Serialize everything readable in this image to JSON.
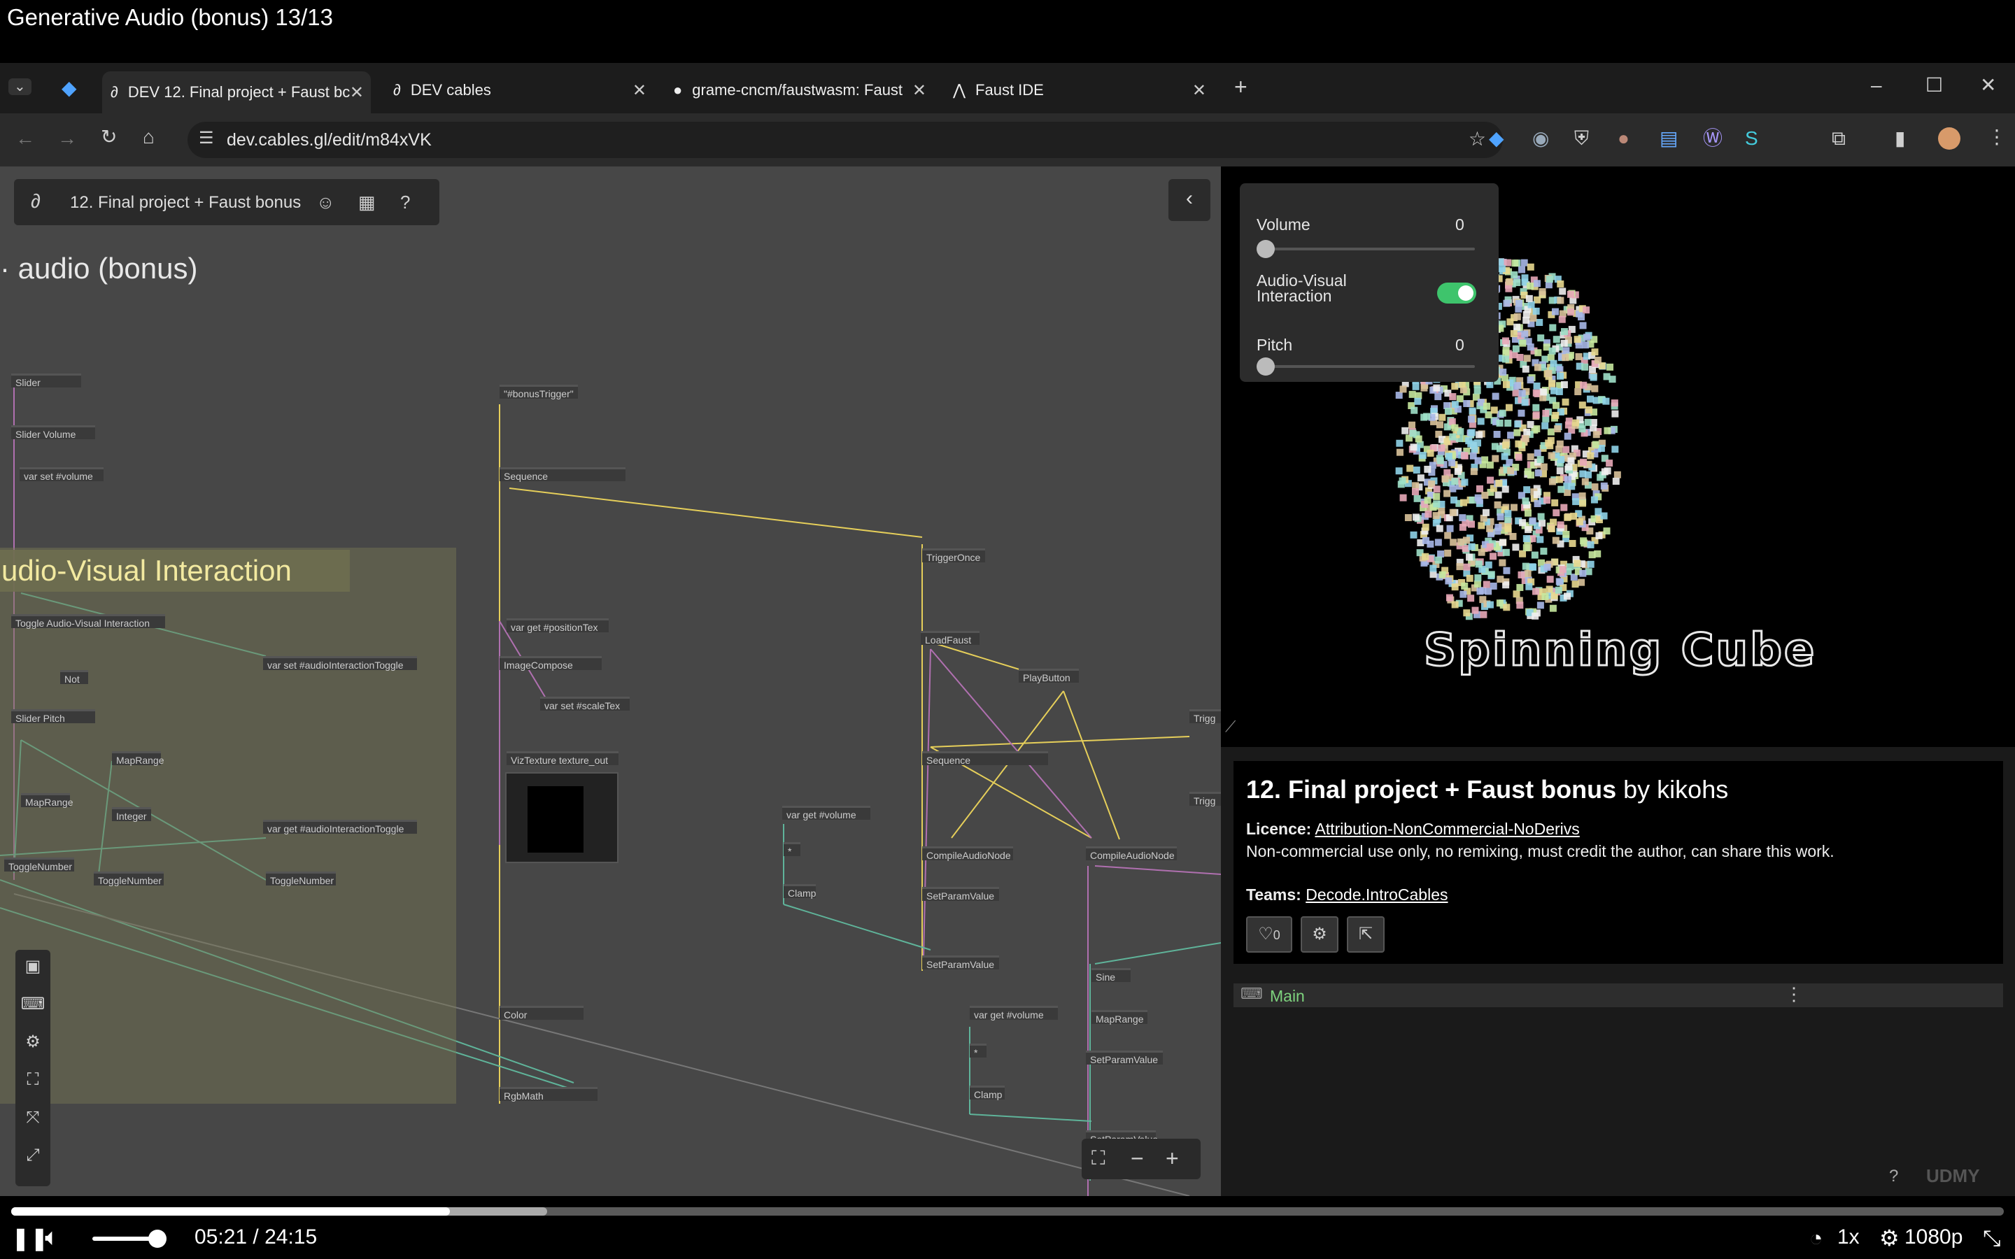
{
  "video": {
    "title": "Generative Audio (bonus) 13/13",
    "time": "05:21 / 24:15",
    "speed": "1x",
    "quality": "1080p",
    "progress_fraction": 0.22
  },
  "browser": {
    "tabs": [
      {
        "label": "DEV 12. Final project + Faust bc",
        "active": true
      },
      {
        "label": "DEV cables",
        "active": false
      },
      {
        "label": "grame-cncm/faustwasm: Faust",
        "active": false
      },
      {
        "label": "Faust IDE",
        "active": false
      }
    ],
    "url": "dev.cables.gl/edit/m84xVK"
  },
  "editor": {
    "project_name": "12. Final project + Faust bonus",
    "section_title": "audio (bonus)",
    "comment_title": "udio-Visual Interaction",
    "ops": [
      {
        "label": "Slider",
        "c": "p"
      },
      {
        "label": "Slider  Volume",
        "c": "p"
      },
      {
        "label": "var  set  #volume",
        "c": "g"
      },
      {
        "label": "\"#bonusTrigger\"",
        "c": "y"
      },
      {
        "label": "Sequence",
        "c": "y"
      },
      {
        "label": "TriggerOnce",
        "c": "y"
      },
      {
        "label": "Toggle  Audio-Visual  Interaction",
        "c": "p"
      },
      {
        "label": "var  set  #audioInteractionToggle",
        "c": "g"
      },
      {
        "label": "Not",
        "c": "g"
      },
      {
        "label": "Slider  Pitch",
        "c": "p"
      },
      {
        "label": "MapRange",
        "c": "g"
      },
      {
        "label": "MapRange",
        "c": "g"
      },
      {
        "label": "Integer",
        "c": "g"
      },
      {
        "label": "var  get  #audioInteractionToggle",
        "c": "g"
      },
      {
        "label": "ToggleNumber",
        "c": "g"
      },
      {
        "label": "ToggleNumber",
        "c": "g"
      },
      {
        "label": "ToggleNumber",
        "c": "g"
      },
      {
        "label": "var  get  #positionTex",
        "c": "p"
      },
      {
        "label": "ImageCompose",
        "c": "p"
      },
      {
        "label": "var  set  #scaleTex",
        "c": "p"
      },
      {
        "label": "VizTexture  texture_out",
        "c": "p"
      },
      {
        "label": "LoadFaust",
        "c": "y"
      },
      {
        "label": "PlayButton",
        "c": "y"
      },
      {
        "label": "Sequence",
        "c": "y"
      },
      {
        "label": "Trigg",
        "c": "y"
      },
      {
        "label": "Trigg",
        "c": "y"
      },
      {
        "label": "var  get  #volume",
        "c": "g"
      },
      {
        "label": "*",
        "c": "g"
      },
      {
        "label": "Clamp",
        "c": "g"
      },
      {
        "label": "CompileAudioNode",
        "c": "y"
      },
      {
        "label": "CompileAudioNode",
        "c": "y"
      },
      {
        "label": "SetParamValue",
        "c": "y"
      },
      {
        "label": "SetParamValue",
        "c": "y"
      },
      {
        "label": "Sine",
        "c": "g"
      },
      {
        "label": "MapRange",
        "c": "g"
      },
      {
        "label": "SetParamValue",
        "c": "y"
      },
      {
        "label": "var  get  #volume",
        "c": "g"
      },
      {
        "label": "*",
        "c": "g"
      },
      {
        "label": "Clamp",
        "c": "g"
      },
      {
        "label": "Color",
        "c": "y"
      },
      {
        "label": "RgbMath",
        "c": "y"
      },
      {
        "label": "SetParamValue",
        "c": "y"
      }
    ]
  },
  "gui": {
    "volume_label": "Volume",
    "volume_value": "0",
    "volume_fraction": 0,
    "toggle_label": "Audio-Visual Interaction",
    "toggle_on": true,
    "pitch_label": "Pitch",
    "pitch_value": "0",
    "pitch_fraction": 0
  },
  "preview": {
    "overlay_text": "Spinning Cube"
  },
  "info": {
    "title": "12. Final project + Faust bonus",
    "by": "by",
    "author": "kikohs",
    "licence_label": "Licence:",
    "licence": "Attribution-NonCommercial-NoDerivs",
    "licence_desc": "Non-commercial use only, no remixing, must credit the author, can share this work.",
    "teams_label": "Teams:",
    "team": "Decode.IntroCables",
    "likes": "0"
  },
  "main_panel": {
    "label": "Main"
  },
  "colors": {
    "accent_green": "#3ec46c",
    "trigger_yellow": "#e6cf5a",
    "number_teal": "#5fb49a",
    "tab_bg": "#2b2b2b"
  }
}
